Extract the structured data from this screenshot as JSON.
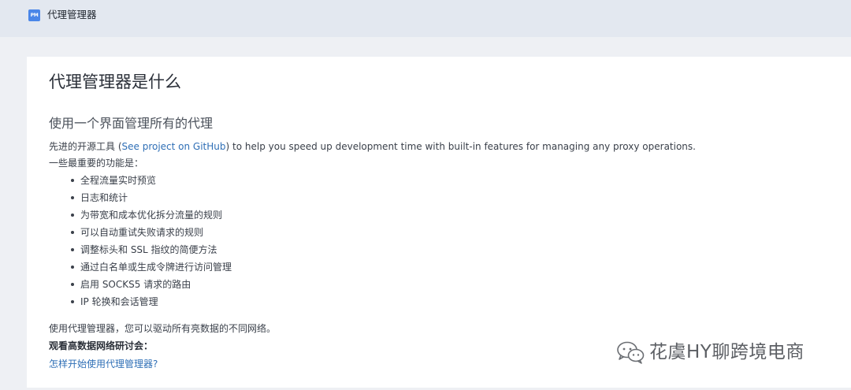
{
  "app": {
    "logo_text": "PM",
    "title": "代理管理器"
  },
  "main": {
    "title": "代理管理器是什么",
    "subtitle": "使用一个界面管理所有的代理",
    "intro_before": "先进的开源工具 (",
    "intro_link": "See project on GitHub",
    "intro_after": ") to help you speed up development time with built-in features for managing any proxy operations.",
    "features_label": "一些最重要的功能是：",
    "features": [
      "全程流量实时预览",
      "日志和统计",
      "为带宽和成本优化拆分流量的规则",
      "可以自动重试失败请求的规则",
      "调整标头和 SSL 指纹的简便方法",
      "通过白名单或生成令牌进行访问管理",
      "启用 SOCKS5 请求的路由",
      "IP 轮换和会话管理"
    ],
    "summary": "使用代理管理器，您可以驱动所有亮数据的不同网络。",
    "webinar_label": "观看高数据网络研讨会：",
    "howto_link": "怎样开始使用代理管理器?"
  },
  "watermark": {
    "icon": "wechat-icon",
    "text": "花虞HY聊跨境电商"
  },
  "colors": {
    "topbar": "#e3e8f0",
    "background": "#eef0f4",
    "link": "#2f6fb6",
    "logo": "#4a86e8"
  }
}
